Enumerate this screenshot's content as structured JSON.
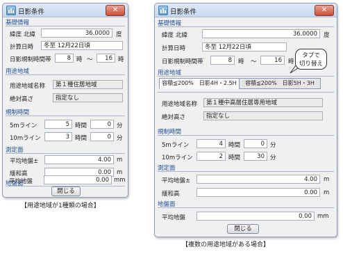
{
  "title": "日影条件",
  "close_glyph": "✕",
  "sections": {
    "base": "基礎情報",
    "zoning": "用途地域",
    "restriction": "規制時間",
    "measure": "測定面",
    "ground": "地盤面"
  },
  "base": {
    "latitude_label": "緯度",
    "north": "北緯",
    "latitude_value": "36.0000",
    "latitude_unit": "度",
    "calc_date_label": "計算日時",
    "calc_date_value": "冬至 12月22日頃",
    "hours_label": "日影規制時間帯",
    "hour_from": "8",
    "hour_unit": "時",
    "tilde": "～",
    "hour_to": "16"
  },
  "zoning_single": {
    "name_label": "用途地域名称",
    "name_value": "第１種住居地域",
    "height_label": "絶対高さ",
    "height_value": "指定なし"
  },
  "zoning_multi": {
    "tabs": [
      "容積≦200%　日影4H・2.5H",
      "容積≦200%　日影5H・3H"
    ],
    "name_label": "用途地域名称",
    "name_value": "第１種中高層住居専用地域",
    "height_label": "絶対高さ",
    "height_value": "指定なし"
  },
  "restriction_single": {
    "row5_label": "5mライン",
    "row5_hours": "5",
    "row5_minutes": "0",
    "row10_label": "10mライン",
    "row10_hours": "3",
    "row10_minutes": "0",
    "hours_unit": "時間",
    "minutes_unit": "分"
  },
  "restriction_multi": {
    "row5_label": "5mライン",
    "row5_hours": "4",
    "row5_minutes": "0",
    "row10_label": "10mライン",
    "row10_hours": "2",
    "row10_minutes": "30",
    "hours_unit": "時間",
    "minutes_unit": "分"
  },
  "measure": {
    "avg_label": "平均地盤±",
    "avg_value": "4.00",
    "avg_unit": "m",
    "ease_label": "緩和高",
    "ease_value": "0.00",
    "ease_unit": "m"
  },
  "ground": {
    "avg_label": "平均地盤",
    "avg_value": "0.00",
    "avg_unit": "mm"
  },
  "ok_label": "閉じる",
  "caption_single": "【用途地域が1種類の場合】",
  "caption_multi": "【複数の用途地域がある場合】",
  "callout": {
    "line1": "タブで",
    "line2": "切り替え"
  }
}
